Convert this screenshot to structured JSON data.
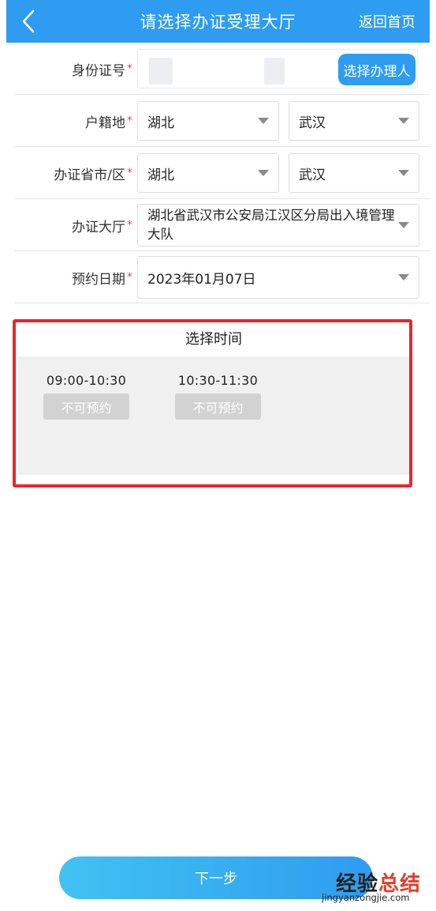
{
  "header": {
    "title": "请选择办证受理大厅",
    "back_icon": "chevron-left-icon",
    "home_link": "返回首页",
    "background_color": "#2e9cf0"
  },
  "form": {
    "id_number": {
      "label": "身份证号",
      "required_mark": "*",
      "value": "",
      "choose_button": "选择办理人"
    },
    "household": {
      "label": "户籍地",
      "required_mark": "*",
      "province": "湖北",
      "city": "武汉"
    },
    "office_city": {
      "label": "办证省市/区",
      "required_mark": "*",
      "province": "湖北",
      "city": "武汉"
    },
    "hall": {
      "label": "办证大厅",
      "required_mark": "*",
      "value": "湖北省武汉市公安局江汉区分局出入境管理大队"
    },
    "date": {
      "label": "预约日期",
      "required_mark": "*",
      "value": "2023年01月07日"
    }
  },
  "time_selection": {
    "title": "选择时间",
    "slots": [
      {
        "time": "09:00-10:30",
        "status": "不可预约"
      },
      {
        "time": "10:30-11:30",
        "status": "不可预约"
      }
    ],
    "highlight_color": "#e5272d"
  },
  "next_button": {
    "label": "下一步"
  },
  "watermark": {
    "main_dark": "经验",
    "main_red": "总结",
    "sub": "jingyanzongjie.com"
  }
}
